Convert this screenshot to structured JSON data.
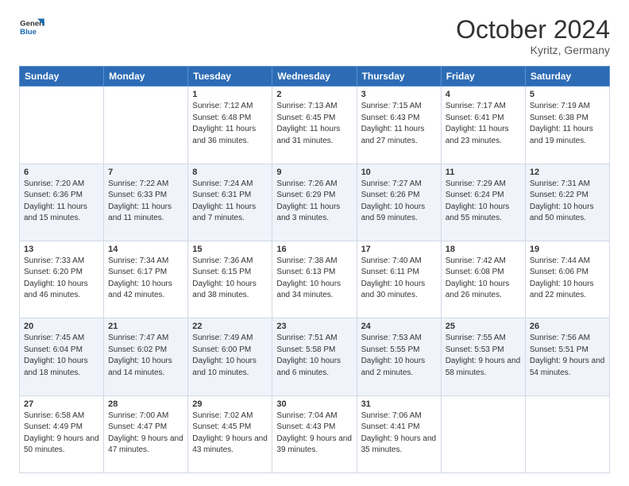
{
  "header": {
    "logo_line1": "General",
    "logo_line2": "Blue",
    "month": "October 2024",
    "location": "Kyritz, Germany"
  },
  "days_of_week": [
    "Sunday",
    "Monday",
    "Tuesday",
    "Wednesday",
    "Thursday",
    "Friday",
    "Saturday"
  ],
  "weeks": [
    [
      {
        "day": "",
        "sunrise": "",
        "sunset": "",
        "daylight": ""
      },
      {
        "day": "",
        "sunrise": "",
        "sunset": "",
        "daylight": ""
      },
      {
        "day": "1",
        "sunrise": "Sunrise: 7:12 AM",
        "sunset": "Sunset: 6:48 PM",
        "daylight": "Daylight: 11 hours and 36 minutes."
      },
      {
        "day": "2",
        "sunrise": "Sunrise: 7:13 AM",
        "sunset": "Sunset: 6:45 PM",
        "daylight": "Daylight: 11 hours and 31 minutes."
      },
      {
        "day": "3",
        "sunrise": "Sunrise: 7:15 AM",
        "sunset": "Sunset: 6:43 PM",
        "daylight": "Daylight: 11 hours and 27 minutes."
      },
      {
        "day": "4",
        "sunrise": "Sunrise: 7:17 AM",
        "sunset": "Sunset: 6:41 PM",
        "daylight": "Daylight: 11 hours and 23 minutes."
      },
      {
        "day": "5",
        "sunrise": "Sunrise: 7:19 AM",
        "sunset": "Sunset: 6:38 PM",
        "daylight": "Daylight: 11 hours and 19 minutes."
      }
    ],
    [
      {
        "day": "6",
        "sunrise": "Sunrise: 7:20 AM",
        "sunset": "Sunset: 6:36 PM",
        "daylight": "Daylight: 11 hours and 15 minutes."
      },
      {
        "day": "7",
        "sunrise": "Sunrise: 7:22 AM",
        "sunset": "Sunset: 6:33 PM",
        "daylight": "Daylight: 11 hours and 11 minutes."
      },
      {
        "day": "8",
        "sunrise": "Sunrise: 7:24 AM",
        "sunset": "Sunset: 6:31 PM",
        "daylight": "Daylight: 11 hours and 7 minutes."
      },
      {
        "day": "9",
        "sunrise": "Sunrise: 7:26 AM",
        "sunset": "Sunset: 6:29 PM",
        "daylight": "Daylight: 11 hours and 3 minutes."
      },
      {
        "day": "10",
        "sunrise": "Sunrise: 7:27 AM",
        "sunset": "Sunset: 6:26 PM",
        "daylight": "Daylight: 10 hours and 59 minutes."
      },
      {
        "day": "11",
        "sunrise": "Sunrise: 7:29 AM",
        "sunset": "Sunset: 6:24 PM",
        "daylight": "Daylight: 10 hours and 55 minutes."
      },
      {
        "day": "12",
        "sunrise": "Sunrise: 7:31 AM",
        "sunset": "Sunset: 6:22 PM",
        "daylight": "Daylight: 10 hours and 50 minutes."
      }
    ],
    [
      {
        "day": "13",
        "sunrise": "Sunrise: 7:33 AM",
        "sunset": "Sunset: 6:20 PM",
        "daylight": "Daylight: 10 hours and 46 minutes."
      },
      {
        "day": "14",
        "sunrise": "Sunrise: 7:34 AM",
        "sunset": "Sunset: 6:17 PM",
        "daylight": "Daylight: 10 hours and 42 minutes."
      },
      {
        "day": "15",
        "sunrise": "Sunrise: 7:36 AM",
        "sunset": "Sunset: 6:15 PM",
        "daylight": "Daylight: 10 hours and 38 minutes."
      },
      {
        "day": "16",
        "sunrise": "Sunrise: 7:38 AM",
        "sunset": "Sunset: 6:13 PM",
        "daylight": "Daylight: 10 hours and 34 minutes."
      },
      {
        "day": "17",
        "sunrise": "Sunrise: 7:40 AM",
        "sunset": "Sunset: 6:11 PM",
        "daylight": "Daylight: 10 hours and 30 minutes."
      },
      {
        "day": "18",
        "sunrise": "Sunrise: 7:42 AM",
        "sunset": "Sunset: 6:08 PM",
        "daylight": "Daylight: 10 hours and 26 minutes."
      },
      {
        "day": "19",
        "sunrise": "Sunrise: 7:44 AM",
        "sunset": "Sunset: 6:06 PM",
        "daylight": "Daylight: 10 hours and 22 minutes."
      }
    ],
    [
      {
        "day": "20",
        "sunrise": "Sunrise: 7:45 AM",
        "sunset": "Sunset: 6:04 PM",
        "daylight": "Daylight: 10 hours and 18 minutes."
      },
      {
        "day": "21",
        "sunrise": "Sunrise: 7:47 AM",
        "sunset": "Sunset: 6:02 PM",
        "daylight": "Daylight: 10 hours and 14 minutes."
      },
      {
        "day": "22",
        "sunrise": "Sunrise: 7:49 AM",
        "sunset": "Sunset: 6:00 PM",
        "daylight": "Daylight: 10 hours and 10 minutes."
      },
      {
        "day": "23",
        "sunrise": "Sunrise: 7:51 AM",
        "sunset": "Sunset: 5:58 PM",
        "daylight": "Daylight: 10 hours and 6 minutes."
      },
      {
        "day": "24",
        "sunrise": "Sunrise: 7:53 AM",
        "sunset": "Sunset: 5:55 PM",
        "daylight": "Daylight: 10 hours and 2 minutes."
      },
      {
        "day": "25",
        "sunrise": "Sunrise: 7:55 AM",
        "sunset": "Sunset: 5:53 PM",
        "daylight": "Daylight: 9 hours and 58 minutes."
      },
      {
        "day": "26",
        "sunrise": "Sunrise: 7:56 AM",
        "sunset": "Sunset: 5:51 PM",
        "daylight": "Daylight: 9 hours and 54 minutes."
      }
    ],
    [
      {
        "day": "27",
        "sunrise": "Sunrise: 6:58 AM",
        "sunset": "Sunset: 4:49 PM",
        "daylight": "Daylight: 9 hours and 50 minutes."
      },
      {
        "day": "28",
        "sunrise": "Sunrise: 7:00 AM",
        "sunset": "Sunset: 4:47 PM",
        "daylight": "Daylight: 9 hours and 47 minutes."
      },
      {
        "day": "29",
        "sunrise": "Sunrise: 7:02 AM",
        "sunset": "Sunset: 4:45 PM",
        "daylight": "Daylight: 9 hours and 43 minutes."
      },
      {
        "day": "30",
        "sunrise": "Sunrise: 7:04 AM",
        "sunset": "Sunset: 4:43 PM",
        "daylight": "Daylight: 9 hours and 39 minutes."
      },
      {
        "day": "31",
        "sunrise": "Sunrise: 7:06 AM",
        "sunset": "Sunset: 4:41 PM",
        "daylight": "Daylight: 9 hours and 35 minutes."
      },
      {
        "day": "",
        "sunrise": "",
        "sunset": "",
        "daylight": ""
      },
      {
        "day": "",
        "sunrise": "",
        "sunset": "",
        "daylight": ""
      }
    ]
  ]
}
